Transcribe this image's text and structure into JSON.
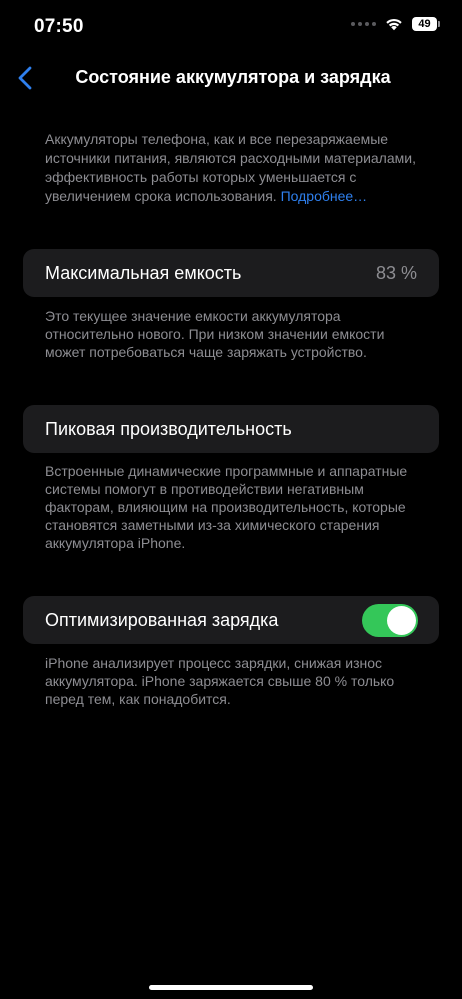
{
  "status_bar": {
    "time": "07:50",
    "battery_level": "49"
  },
  "nav": {
    "title": "Состояние аккумулятора и зарядка",
    "back_icon": "chevron-left-icon"
  },
  "intro": {
    "text": "Аккумуляторы телефона, как и все перезаряжаемые источники питания, являются расходными материалами, эффективность работы которых уменьшается с увеличением срока использования.",
    "link": "Подробнее…"
  },
  "max_capacity": {
    "label": "Максимальная емкость",
    "value": "83 %",
    "footnote": "Это текущее значение емкости аккумулятора относительно нового. При низком значении емкости может потребоваться чаще заряжать устройство."
  },
  "peak_performance": {
    "label": "Пиковая производительность",
    "footnote": "Встроенные динамические программные и аппаратные системы помогут в противодействии негативным факторам, влияющим на производительность, которые становятся заметными из-за химического старения аккумулятора iPhone."
  },
  "optimized_charging": {
    "label": "Оптимизированная зарядка",
    "enabled": true,
    "footnote": "iPhone анализирует процесс зарядки, снижая износ аккумулятора. iPhone заряжается свыше 80 % только перед тем, как понадобится."
  },
  "colors": {
    "background": "#000000",
    "card": "#1c1c1e",
    "secondary_text": "#8d8d92",
    "accent": "#2f80ee",
    "toggle_on": "#34c759"
  }
}
